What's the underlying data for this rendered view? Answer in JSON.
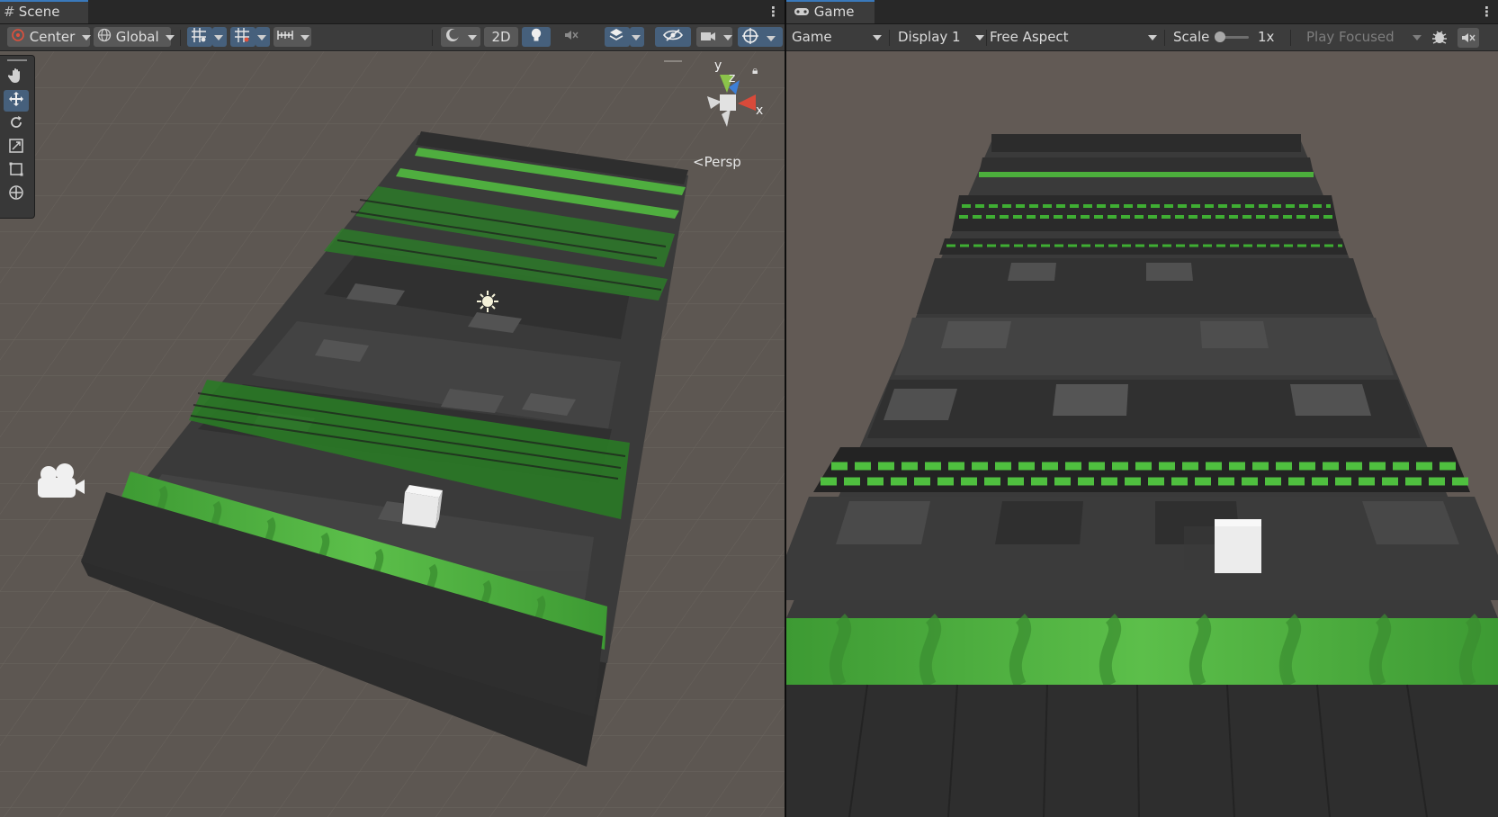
{
  "scene": {
    "tab_label": "Scene",
    "toolbar": {
      "pivot_label": "Center",
      "space_label": "Global",
      "mode_2d_label": "2D"
    },
    "gizmo": {
      "axis_x": "x",
      "axis_y": "y",
      "axis_z": "z",
      "projection_label": "Persp"
    },
    "tools": [
      {
        "name": "hand-tool-icon"
      },
      {
        "name": "move-tool-icon",
        "active": true
      },
      {
        "name": "rotate-tool-icon"
      },
      {
        "name": "scale-tool-icon"
      },
      {
        "name": "rect-tool-icon"
      },
      {
        "name": "transform-tool-icon"
      }
    ]
  },
  "game": {
    "tab_label": "Game",
    "toolbar": {
      "view_label": "Game",
      "display_label": "Display 1",
      "aspect_label": "Free Aspect",
      "scale_label": "Scale",
      "scale_value": "1x",
      "play_mode_label": "Play Focused"
    }
  },
  "colors": {
    "tab_active": "#3a79bb",
    "toggle_on": "#46607c",
    "scene_bg": "#5d5752",
    "game_bg": "#625a55",
    "grass_light": "#5cbf4a",
    "grass_dark": "#3d9a33",
    "tile_dark": "#2f2f2f",
    "tile_light": "#474747"
  }
}
